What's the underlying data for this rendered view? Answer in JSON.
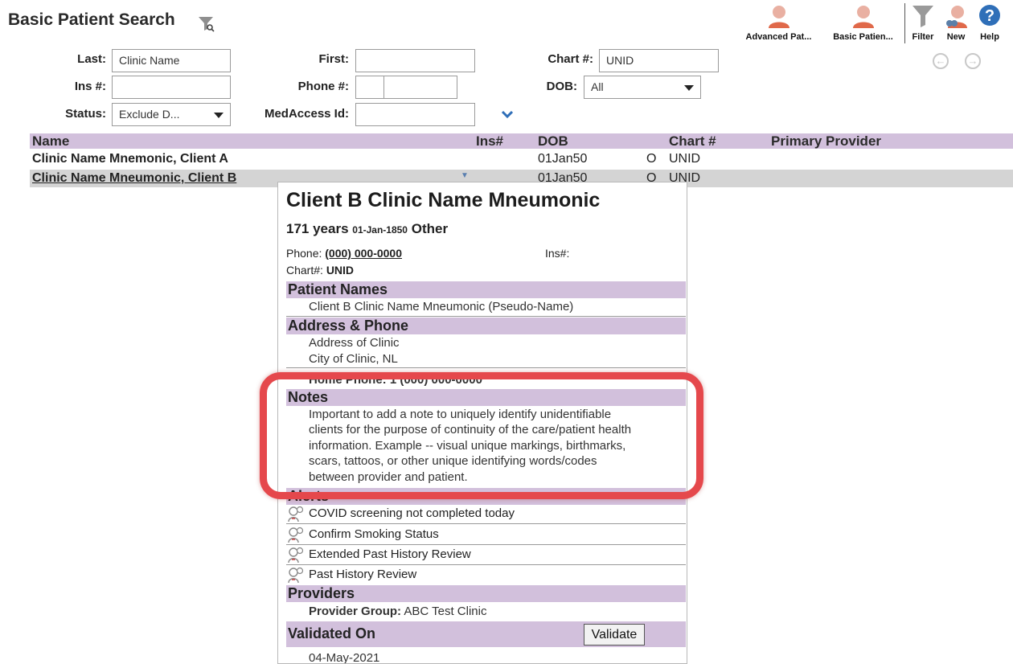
{
  "header": {
    "title": "Basic Patient Search",
    "toolbar": [
      {
        "label": "Advanced Pat...",
        "icon": "person-icon"
      },
      {
        "label": "Basic Patien...",
        "icon": "person-icon"
      },
      {
        "label": "Filter",
        "icon": "filter-icon"
      },
      {
        "label": "New",
        "icon": "new-person-icon"
      },
      {
        "label": "Help",
        "icon": "help-icon"
      }
    ]
  },
  "form": {
    "last_label": "Last:",
    "last_value": "Clinic Name",
    "first_label": "First:",
    "first_value": "",
    "chart_label": "Chart #:",
    "chart_value": "UNID",
    "ins_label": "Ins #:",
    "ins_value": "",
    "phone_label": "Phone #:",
    "dob_label": "DOB:",
    "dob_value": "All",
    "status_label": "Status:",
    "status_value": "Exclude D...",
    "medaccess_label": "MedAccess Id:",
    "medaccess_value": ""
  },
  "results": {
    "headers": {
      "name": "Name",
      "ins": "Ins#",
      "dob": "DOB",
      "chart": "Chart #",
      "provider": "Primary Provider"
    },
    "rows": [
      {
        "name": "Clinic Name Mnemonic, Client A",
        "dob": "01Jan50",
        "gender": "O",
        "chart": "UNID"
      },
      {
        "name": "Clinic Name Mneumonic, Client B",
        "dob": "01Jan50",
        "gender": "O",
        "chart": "UNID"
      }
    ]
  },
  "popup": {
    "name": "Client B Clinic Name Mneumonic",
    "age": "171 years",
    "dob": "01-Jan-1850",
    "gender": "Other",
    "phone_label": "Phone:",
    "phone_value": "(000) 000-0000",
    "ins_label": "Ins#:",
    "chart_label": "Chart#:",
    "chart_value": "UNID",
    "sections": {
      "names": "Patient Names",
      "address": "Address & Phone",
      "notes": "Notes",
      "alerts": "Alerts",
      "providers": "Providers",
      "validated": "Validated On"
    },
    "pseudo_name": "Client B Clinic Name Mneumonic (Pseudo-Name)",
    "address_line1": "Address of Clinic",
    "address_line2": "City of Clinic, NL",
    "home_phone": "Home Phone: 1 (000) 000-0000",
    "notes_lines": [
      "Important to add a note to uniquely identify unidentifiable",
      "clients for the purpose of continuity of the care/patient health",
      "information. Example -- visual unique markings, birthmarks,",
      "scars, tattoos, or other unique identifying words/codes",
      "between provider and patient."
    ],
    "alerts": [
      "COVID screening not completed today",
      "Confirm Smoking Status",
      "Extended Past History Review",
      "Past History Review"
    ],
    "provider_group_label": "Provider Group:",
    "provider_group_value": "ABC Test Clinic",
    "validate_button": "Validate",
    "validated_date": "04-May-2021"
  },
  "colors": {
    "section_bg": "#d2c0dc",
    "highlight": "#e5484c",
    "person_icon": "#e0694a"
  }
}
